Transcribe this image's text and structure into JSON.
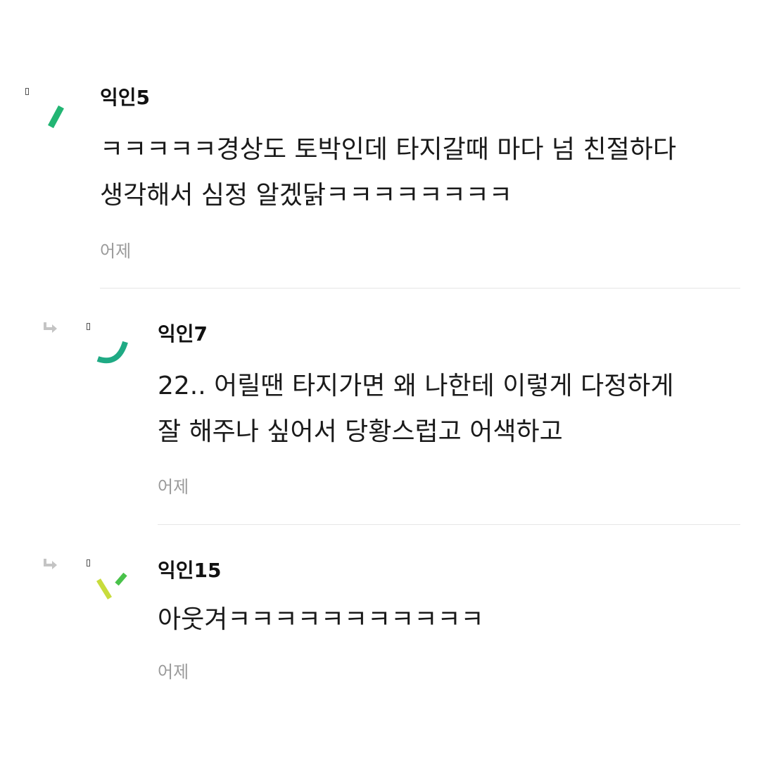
{
  "comments": [
    {
      "author": "익인5",
      "lines": [
        "ㅋㅋㅋㅋㅋ경상도 토박인데 타지갈때 마다 넘 친절하다",
        "생각해서 심정 알겠닭ㅋㅋㅋㅋㅋㅋㅋㅋ"
      ],
      "time": "어제",
      "avatar_icon": "green-dash-icon",
      "is_reply": false
    },
    {
      "author": "익인7",
      "lines": [
        "22.. 어릴땐 타지가면 왜 나한테 이렇게 다정하게",
        "잘 해주나 싶어서 당황스럽고 어색하고"
      ],
      "time": "어제",
      "avatar_icon": "green-smile-arc-icon",
      "is_reply": true
    },
    {
      "author": "익인15",
      "lines": [
        "아웃겨ㅋㅋㅋㅋㅋㅋㅋㅋㅋㅋㅋ"
      ],
      "time": "어제",
      "avatar_icon": "lime-slashes-icon",
      "is_reply": true
    }
  ],
  "colors": {
    "avatar_green": "#22b573",
    "avatar_teal": "#1faa84",
    "avatar_lime": "#c8dc3c",
    "avatar_leaf": "#49c24a",
    "time_gray": "#9a9a9a",
    "divider": "#e6e6e6"
  }
}
